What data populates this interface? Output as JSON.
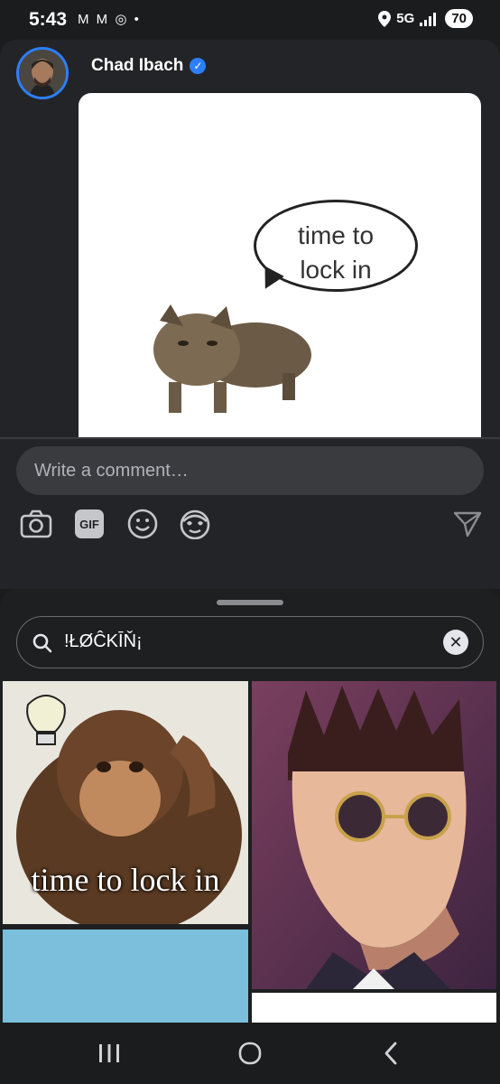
{
  "status_bar": {
    "time": "5:43",
    "left_icons": "M M ◎ •",
    "network": "5G",
    "battery": "70"
  },
  "post": {
    "author": "Chad Ibach",
    "verified": true,
    "image_text": "time to\nlock in"
  },
  "comment": {
    "placeholder": "Write a comment…",
    "icons": [
      "camera-icon",
      "gif-icon",
      "emoji-icon",
      "sticker-icon",
      "send-icon"
    ],
    "gif_label": "GIF"
  },
  "gif_picker": {
    "search_value": "!ŁØĈKĪŇ¡",
    "results": [
      {
        "caption": "time to lock in"
      },
      {
        "caption": ""
      },
      {
        "caption": ""
      },
      {
        "caption": ""
      }
    ]
  },
  "colors": {
    "accent": "#2d7ff9",
    "background": "#1b1c1e",
    "card": "#232427",
    "input": "#3a3b3e"
  }
}
